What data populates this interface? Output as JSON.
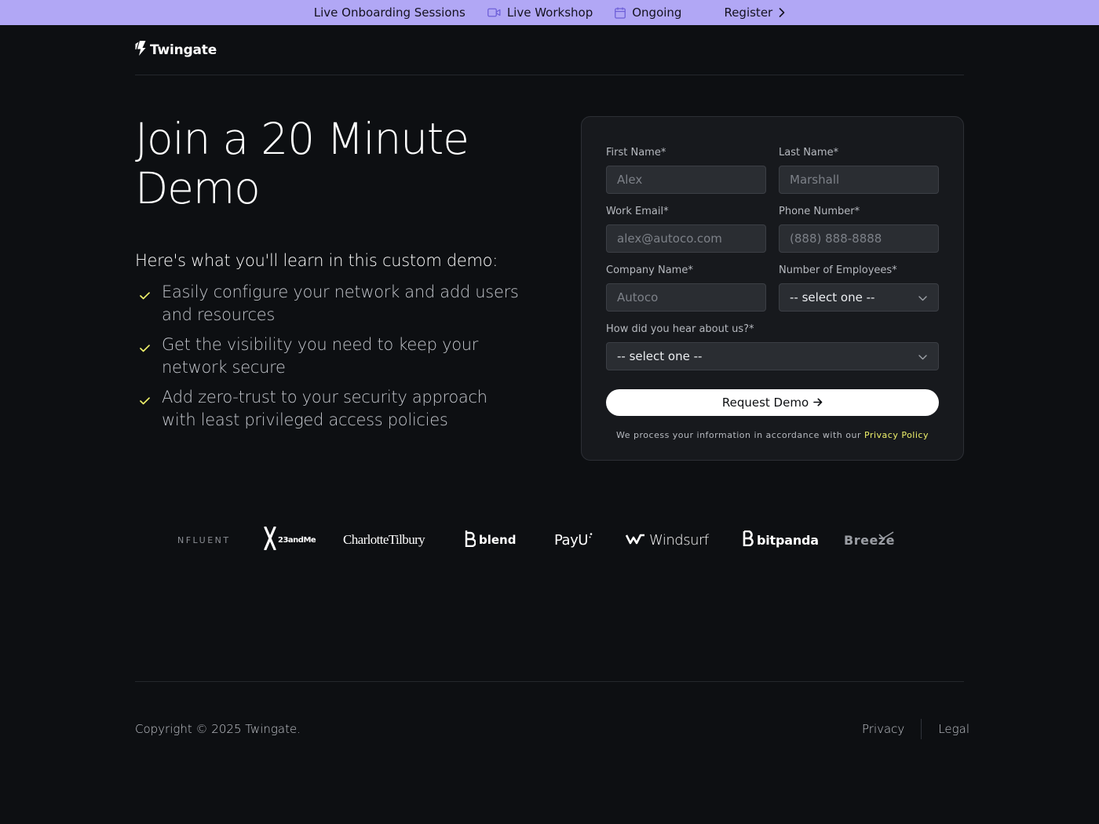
{
  "banner": {
    "title": "Live Onboarding Sessions",
    "type_label": "Live Workshop",
    "type_icon": "video-icon",
    "schedule_label": "Ongoing",
    "schedule_icon": "calendar-icon",
    "cta_label": "Register",
    "background": "#b1a7f5"
  },
  "header": {
    "logo_text": "Twingate"
  },
  "hero": {
    "title": "Join a 20 Minute Demo",
    "learn_heading": "Here's what you'll learn in this custom demo:",
    "bullets": [
      "Easily configure your network and add users and resources",
      "Get the visibility you need to keep your network secure",
      "Add zero-trust to your security approach with least privileged access policies"
    ],
    "check_color": "#eef06a"
  },
  "form": {
    "first_name": {
      "label": "First Name*",
      "placeholder": "Alex",
      "value": ""
    },
    "last_name": {
      "label": "Last Name*",
      "placeholder": "Marshall",
      "value": ""
    },
    "work_email": {
      "label": "Work Email*",
      "placeholder": "alex@autoco.com",
      "value": ""
    },
    "phone": {
      "label": "Phone Number*",
      "placeholder": "(888) 888-8888",
      "value": ""
    },
    "company": {
      "label": "Company Name*",
      "placeholder": "Autoco",
      "value": ""
    },
    "employees": {
      "label": "Number of Employees*",
      "selected": "-- select one --"
    },
    "hear_about": {
      "label": "How did you hear about us?*",
      "selected": "-- select one --"
    },
    "submit_label": "Request Demo",
    "privacy_prefix": "We process your information in accordance with our",
    "privacy_link": "Privacy Policy",
    "accent": "#eef06a"
  },
  "customer_logos": {
    "confluent": "NFLUENT",
    "twentythree": "23andMe",
    "charlotte": "CharlotteTilbury",
    "blend": "blend",
    "payu": "PayU",
    "windsurf": "Windsurf",
    "bitpanda": "bitpanda",
    "breeze": "Breeze"
  },
  "footer": {
    "copyright": "Copyright © 2025 Twingate.",
    "links": [
      "Privacy",
      "Legal"
    ]
  }
}
